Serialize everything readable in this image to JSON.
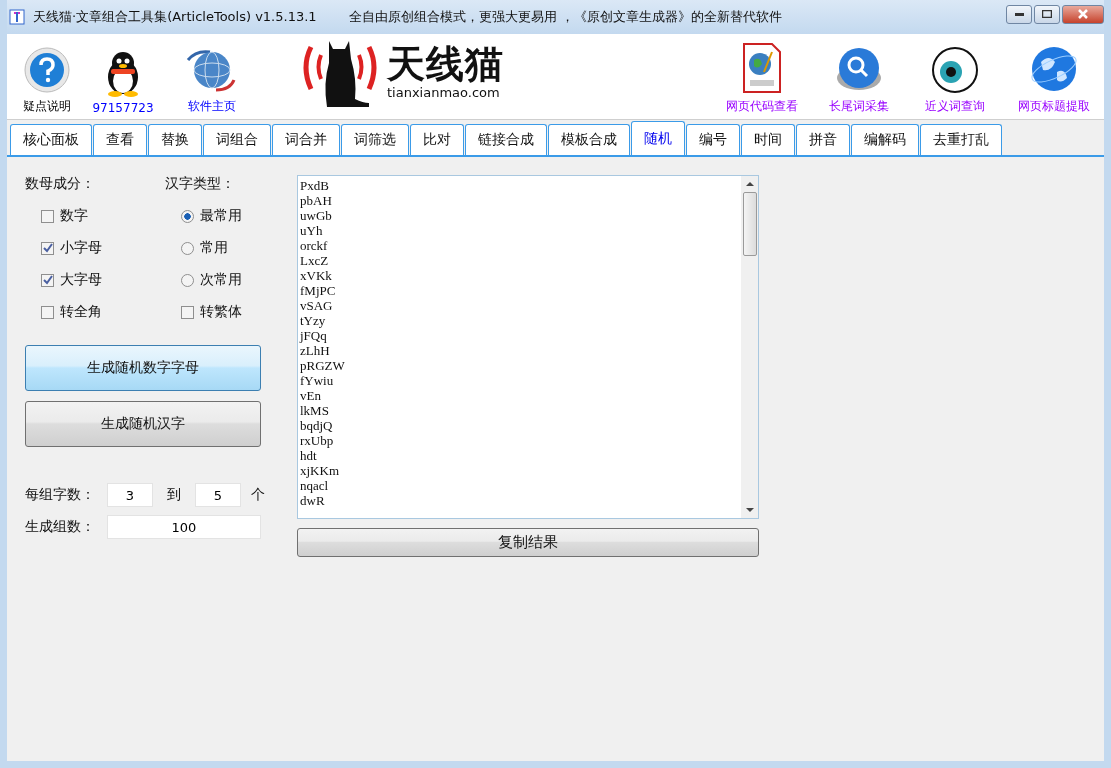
{
  "window": {
    "title": "天线猫·文章组合工具集(ArticleTools) v1.5.13.1",
    "subtitle": "全自由原创组合模式，更强大更易用 ，《原创文章生成器》的全新替代软件"
  },
  "toolbar_left": [
    {
      "kind": "help",
      "label": "疑点说明"
    },
    {
      "kind": "penguin",
      "label": "97157723"
    },
    {
      "kind": "globe",
      "label": "软件主页"
    }
  ],
  "logo": {
    "name": "天线猫",
    "site": "tianxianmao.com"
  },
  "toolbar_right": [
    {
      "kind": "html",
      "label": "网页代码查看"
    },
    {
      "kind": "search",
      "label": "长尾词采集"
    },
    {
      "kind": "eye",
      "label": "近义词查询"
    },
    {
      "kind": "earth",
      "label": "网页标题提取"
    }
  ],
  "tabs": [
    {
      "label": "核心面板",
      "selected": false
    },
    {
      "label": "查看",
      "selected": false
    },
    {
      "label": "替换",
      "selected": false
    },
    {
      "label": "词组合",
      "selected": false
    },
    {
      "label": "词合并",
      "selected": false
    },
    {
      "label": "词筛选",
      "selected": false
    },
    {
      "label": "比对",
      "selected": false
    },
    {
      "label": "链接合成",
      "selected": false
    },
    {
      "label": "模板合成",
      "selected": false
    },
    {
      "label": "随机",
      "selected": true
    },
    {
      "label": "编号",
      "selected": false
    },
    {
      "label": "时间",
      "selected": false
    },
    {
      "label": "拼音",
      "selected": false
    },
    {
      "label": "编解码",
      "selected": false
    },
    {
      "label": "去重打乱",
      "selected": false
    }
  ],
  "left_group": {
    "title": "数母成分：",
    "options": [
      {
        "kind": "checkbox",
        "label": "数字",
        "checked": false
      },
      {
        "kind": "checkbox",
        "label": "小字母",
        "checked": true
      },
      {
        "kind": "checkbox",
        "label": "大字母",
        "checked": true
      },
      {
        "kind": "checkbox",
        "label": "转全角",
        "checked": false
      }
    ]
  },
  "right_group": {
    "title": "汉字类型：",
    "options": [
      {
        "kind": "radio",
        "label": "最常用",
        "checked": true
      },
      {
        "kind": "radio",
        "label": "常用",
        "checked": false
      },
      {
        "kind": "radio",
        "label": "次常用",
        "checked": false
      },
      {
        "kind": "checkbox",
        "label": "转繁体",
        "checked": false
      }
    ]
  },
  "buttons": [
    {
      "label": "生成随机数字字母",
      "focused": true
    },
    {
      "label": "生成随机汉字",
      "focused": false
    }
  ],
  "per_group": {
    "label": "每组字数：",
    "from": "3",
    "to_label": "到",
    "to": "5",
    "unit": "个"
  },
  "group_count": {
    "label": "生成组数：",
    "value": "100"
  },
  "results": [
    "PxdB",
    "pbAH",
    "uwGb",
    "uYh",
    "orckf",
    "LxcZ",
    "xVKk",
    "fMjPC",
    "vSAG",
    "tYzy",
    "jFQq",
    "zLhH",
    "pRGZW",
    "fYwiu",
    "vEn",
    "lkMS",
    "bqdjQ",
    "rxUbp",
    "hdt",
    "xjKKm",
    "nqacl",
    "dwR"
  ],
  "copy_button": "复制结果"
}
